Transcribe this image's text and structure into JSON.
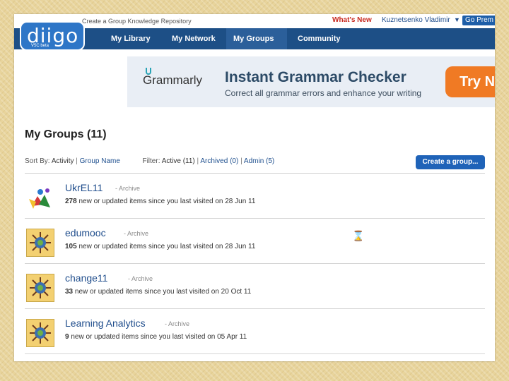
{
  "topbar": {
    "tagline": "Create a Group Knowledge Repository",
    "whats_new": "What's New",
    "username": "Kuznetsenko Vladimir",
    "user_menu_arrow": "▼",
    "premium_button": "Go Prem"
  },
  "logo": {
    "text": "diigo",
    "sub": "V5C beta"
  },
  "nav": {
    "items": [
      {
        "label": "My Library",
        "active": false
      },
      {
        "label": "My Network",
        "active": false
      },
      {
        "label": "My Groups",
        "active": true
      },
      {
        "label": "Community",
        "active": false
      }
    ]
  },
  "ad": {
    "brand": "Grammarly",
    "title": "Instant Grammar Checker",
    "subtitle": "Correct all grammar errors and enhance your writing",
    "cta": "Try N"
  },
  "page": {
    "title": "My Groups (11)",
    "sort_label": "Sort By:",
    "sort_active": "Activity",
    "sort_sep": "|",
    "sort_alt": "Group Name",
    "filter_label": "Filter:",
    "filter_active": "Active (11)",
    "filter_archived": "Archived (0)",
    "filter_admin": "Admin (5)",
    "create_button": "Create a group..."
  },
  "groups": [
    {
      "name": "UkrEL11",
      "archive": "- Archive",
      "count": "278",
      "desc": "new or updated items since you last visited on 28 Jun 11"
    },
    {
      "name": "edumooc",
      "archive": "- Archive",
      "count": "105",
      "desc": "new or updated items since you last visited on 28 Jun 11"
    },
    {
      "name": "change11",
      "archive": "- Archive",
      "count": "33",
      "desc": "new or updated items since you last visited on 20 Oct 11"
    },
    {
      "name": "Learning Analytics",
      "archive": "- Archive",
      "count": "9",
      "desc": "new or updated items since you last visited on 05 Apr 11"
    }
  ],
  "cursor": {
    "icon": "hourglass-icon",
    "glyph": "⌛"
  },
  "colors": {
    "nav_bg": "#1d4f86",
    "accent_blue": "#1f63b8",
    "ad_orange": "#f07a24",
    "link": "#1f4d8c",
    "frame": "#e8d49c"
  }
}
